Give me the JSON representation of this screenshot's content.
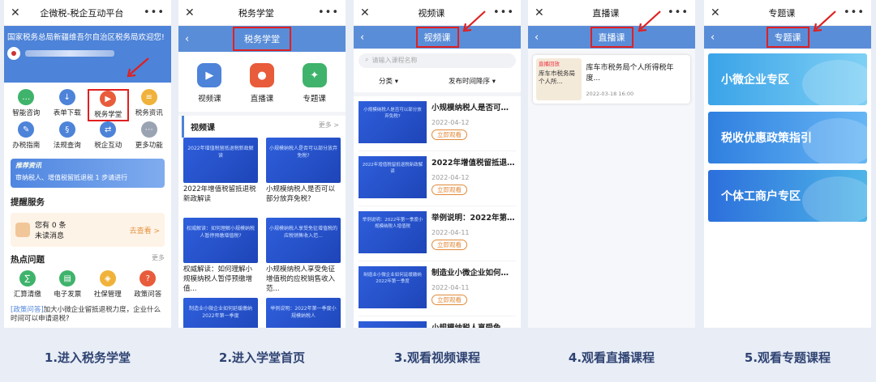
{
  "colors": {
    "accent": "#5a8dd8",
    "highlight": "#e02020",
    "caption": "#2f4372"
  },
  "captions": [
    "1.进入税务学堂",
    "2.进入学堂首页",
    "3.观看视频课程",
    "4.观看直播课程",
    "5.观看专题课程"
  ],
  "p1": {
    "title": "企微税-税企互动平台",
    "welcome": "国家税务总局新疆维吾尔自治区税务局欢迎您!",
    "grid": [
      {
        "label": "智能咨询",
        "icon": "chat-icon",
        "color": "#3fb36b"
      },
      {
        "label": "表单下载",
        "icon": "download-icon",
        "color": "#4d83d8"
      },
      {
        "label": "税务学堂",
        "icon": "play-icon",
        "color": "#e85b3b"
      },
      {
        "label": "税务资讯",
        "icon": "news-icon",
        "color": "#f0b23a"
      },
      {
        "label": "办税指南",
        "icon": "guide-icon",
        "color": "#4d83d8"
      },
      {
        "label": "法规查询",
        "icon": "law-icon",
        "color": "#4d83d8"
      },
      {
        "label": "税企互动",
        "icon": "interact-icon",
        "color": "#4d83d8"
      },
      {
        "label": "更多功能",
        "icon": "more-icon",
        "color": "#9aa3b2"
      }
    ],
    "rec_title": "推荐资讯",
    "rec_text": "审纳税人、增值税留抵退税 1 步请进行",
    "remind_title": "提醒服务",
    "remind_line1": "您有 0 条",
    "remind_line2": "未读消息",
    "remind_go": "去查看 >",
    "hot_title": "热点问题",
    "hot_more": "更多",
    "hot": [
      {
        "label": "汇算清缴",
        "icon": "calc-icon",
        "color": "#3fb36b"
      },
      {
        "label": "电子发票",
        "icon": "invoice-icon",
        "color": "#3fb36b"
      },
      {
        "label": "社保管理",
        "icon": "shield-icon",
        "color": "#f0b23a"
      },
      {
        "label": "政策问答",
        "icon": "qa-icon",
        "color": "#e85b3b"
      }
    ],
    "hq_tag": "[政策问答]",
    "hq_text": "加大小微企业留抵退税力度，企业什么时间可以申请退税?"
  },
  "p2": {
    "title": "税务学堂",
    "cats": [
      {
        "label": "视频课",
        "icon": "video-icon",
        "color": "#4d83d8"
      },
      {
        "label": "直播课",
        "icon": "live-icon",
        "color": "#e85b3b"
      },
      {
        "label": "专题课",
        "icon": "topic-icon",
        "color": "#3fb36b"
      }
    ],
    "video_head": "视频课",
    "more": "更多 >",
    "videos": [
      {
        "thumb": "2022年增值税留抵退税新政解读",
        "cap": "2022年增值税留抵退税新政解读"
      },
      {
        "thumb": "小规模纳税人是否可以部分放弃免税?",
        "cap": "小规模纳税人是否可以部分放弃免税?"
      },
      {
        "thumb": "权威解读：如何理解小规模纳税人暂停预缴增值税?",
        "cap": "权威解读：如何理解小规模纳税人暂停预缴增值..."
      },
      {
        "thumb": "小规模纳税人享受免征增值税的应税销售收入范...",
        "cap": "小规模纳税人享受免征增值税的应税销售收入范..."
      },
      {
        "thumb": "制造业小微企业如何延缓缴纳2022年第一季度",
        "cap": ""
      },
      {
        "thumb": "举例说明：2022年第一季度小规模纳税人",
        "cap": ""
      }
    ]
  },
  "p3": {
    "title": "视频课",
    "search_placeholder": "请输入课程名称",
    "filter1": "分类",
    "filter2": "发布时间降序",
    "btn": "立即观看",
    "items": [
      {
        "thumb": "小规模纳税人是否可以部分放弃免税?",
        "title": "小规模纳税人是否可以...",
        "date": "2022-04-12"
      },
      {
        "thumb": "2022年增值税留抵退税新政解读",
        "title": "2022年增值税留抵退税...",
        "date": "2022-04-12"
      },
      {
        "thumb": "举例说明：2022年第一季度小规模纳税人增值税",
        "title": "举例说明：2022年第一...",
        "date": "2022-04-11"
      },
      {
        "thumb": "制造业小微企业如何延缓缴纳2022年第一季度",
        "title": "制造业小微企业如何延...",
        "date": "2022-04-11"
      },
      {
        "thumb": "",
        "title": "小规模纳税人享受免征...",
        "date": ""
      }
    ]
  },
  "p4": {
    "title": "直播课",
    "badge": "直播回放",
    "thumb_text": "库车市税务局个人所...",
    "item_title": "库车市税务局个人所得税年度...",
    "item_date": "2022-03-18 16:00"
  },
  "p5": {
    "title": "专题课",
    "topics": [
      {
        "label": "小微企业专区",
        "color1": "#3aa3e8",
        "color2": "#7fd0f5"
      },
      {
        "label": "税收优惠政策指引",
        "color1": "#2f7fe0",
        "color2": "#66b6f5"
      },
      {
        "label": "个体工商户专区",
        "color1": "#2c6fdc",
        "color2": "#4fb5e8"
      }
    ]
  }
}
